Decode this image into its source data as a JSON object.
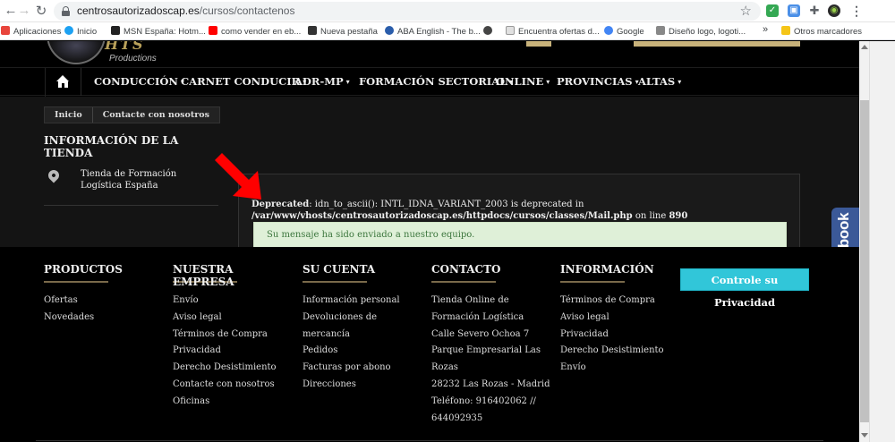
{
  "browser": {
    "url_domain": "centrosautorizadoscap.es",
    "url_path": "/cursos/contactenos",
    "bookmarks": [
      {
        "label": "Aplicaciones",
        "color": "#e8453c"
      },
      {
        "label": "Inicio",
        "color": "#1da1f2"
      },
      {
        "label": "MSN España: Hotm...",
        "color": "#222222"
      },
      {
        "label": "como vender en eb...",
        "color": "#ff0000"
      },
      {
        "label": "Nueva pestaña",
        "color": "#333333"
      },
      {
        "label": "ABA English - The b...",
        "color": "#2a5dab"
      },
      {
        "label": "",
        "color": "#444444"
      },
      {
        "label": "Encuentra ofertas d...",
        "color": "#e0e0e0"
      },
      {
        "label": "Google",
        "color": "#4285f4"
      },
      {
        "label": "Diseño logo, logoti...",
        "color": "#888888"
      }
    ],
    "more_label": "»",
    "other_bookmarks": "Otros marcadores"
  },
  "logo": {
    "text": "HTS",
    "subtitle": "Productions"
  },
  "nav": {
    "items": [
      {
        "label": "CONDUCCIÓN"
      },
      {
        "label": "CARNET CONDUCIR"
      },
      {
        "label": "ADR-MP"
      },
      {
        "label": "FORMACIÓN SECTORIAL"
      },
      {
        "label": "ONLINE"
      },
      {
        "label": "PROVINCIAS"
      },
      {
        "label": "ALTAS"
      }
    ],
    "caret": "▾"
  },
  "breadcrumb": {
    "home": "Inicio",
    "current": "Contacte con nosotros"
  },
  "store": {
    "title": "INFORMACIÓN DE LA TIENDA",
    "name": "Tienda de Formación Logística España"
  },
  "message": {
    "deprecated_label": "Deprecated",
    "deprecated_text": ": idn_to_ascii(): INTL_IDNA_VARIANT_2003 is deprecated in",
    "file_path": "/var/www/vhosts/centrosautorizadoscap.es/httpdocs/cursos/classes/Mail.php",
    "on_line": " on line ",
    "line_number": "890",
    "success": "Su mensaje ha sido enviado a nuestro equipo."
  },
  "facebook_tab": "facebook",
  "footer": {
    "columns": [
      {
        "title": "PRODUCTOS",
        "links": [
          "Ofertas",
          "Novedades"
        ]
      },
      {
        "title": "NUESTRA EMPRESA",
        "links": [
          "Envío",
          "Aviso legal",
          "Términos de Compra",
          "Privacidad",
          "Derecho Desistimiento",
          "Contacte con nosotros",
          "Oficinas"
        ]
      },
      {
        "title": "SU CUENTA",
        "links": [
          "Información personal",
          "Devoluciones de",
          "mercancía",
          "Pedidos",
          "Facturas por abono",
          "Direcciones"
        ]
      },
      {
        "title": "CONTACTO",
        "links": [
          "Tienda Online de",
          "Formación Logística",
          "Calle Severo Ochoa 7",
          "Parque Empresarial Las",
          "Rozas",
          "28232 Las Rozas - Madrid",
          "Teléfono: 916402062 //",
          "644092935"
        ]
      },
      {
        "title": "INFORMACIÓN",
        "links": [
          "Términos de Compra",
          "Aviso legal",
          "Privacidad",
          "Derecho Desistimiento",
          "Envío"
        ]
      }
    ],
    "privacy_button": "Controle su Privacidad"
  },
  "colors": {
    "accent_gold": "#c8b27a",
    "success_bg": "#dff0d8",
    "success_text": "#3c763d",
    "facebook_blue": "#3b5998",
    "privacy_cyan": "#31c6d9",
    "arrow_red": "#ff0000"
  }
}
